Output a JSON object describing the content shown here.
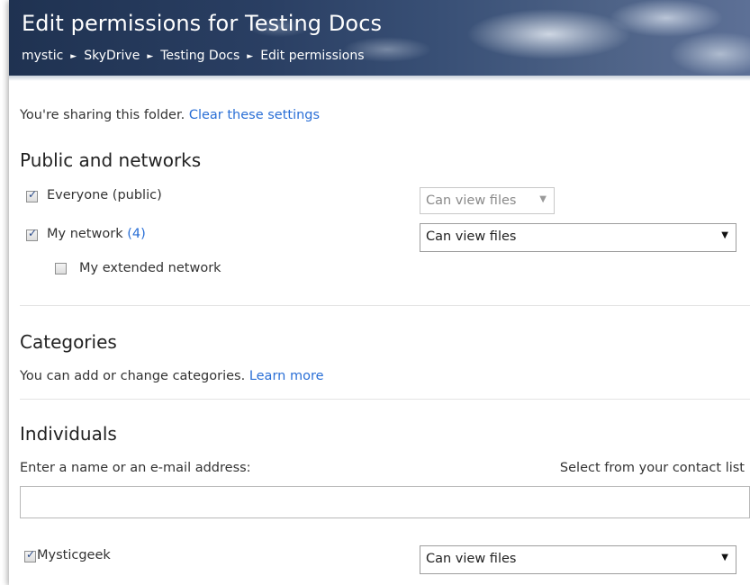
{
  "header": {
    "title": "Edit permissions for Testing Docs",
    "breadcrumb": [
      "mystic",
      "SkyDrive",
      "Testing Docs",
      "Edit permissions"
    ],
    "separator": "►"
  },
  "sharing": {
    "status_text": "You're sharing this folder.",
    "clear_link": "Clear these settings"
  },
  "public_networks": {
    "heading": "Public and networks",
    "everyone": {
      "label": "Everyone (public)",
      "checked": true,
      "permission": "Can view files",
      "disabled": true
    },
    "my_network": {
      "label": "My network",
      "count": "(4)",
      "checked": true,
      "permission": "Can view files"
    },
    "extended": {
      "label": "My extended network",
      "checked": false
    }
  },
  "categories": {
    "heading": "Categories",
    "text": "You can add or change categories.",
    "learn_more": "Learn more"
  },
  "individuals": {
    "heading": "Individuals",
    "prompt": "Enter a name or an e-mail address:",
    "contact_link": "Select from your contact list",
    "input_value": "",
    "people": [
      {
        "name": "Mysticgeek",
        "checked": true,
        "permission": "Can view files"
      }
    ]
  },
  "icons": {
    "dropdown": "chevron-down-icon",
    "check": "checkmark-icon"
  },
  "colors": {
    "link": "#2a6fd6",
    "header_dark": "#1f3251",
    "header_light": "#5d7096"
  }
}
